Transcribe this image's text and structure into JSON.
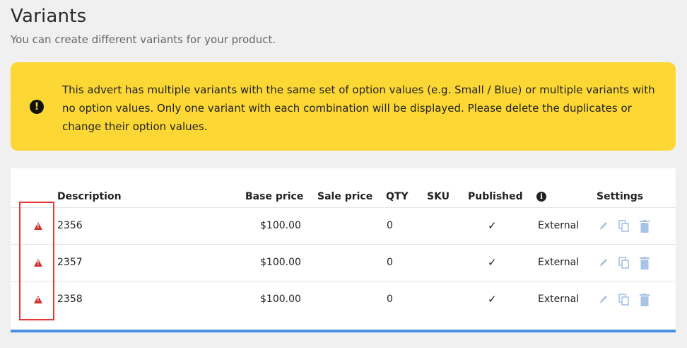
{
  "page": {
    "title": "Variants",
    "subtitle": "You can create different variants for your product."
  },
  "alert": {
    "icon": "exclamation-circle-icon",
    "message": "This advert has multiple variants with the same set of option values (e.g. Small / Blue) or multiple variants with no option values. Only one variant with each combination will be displayed. Please delete the duplicates or change their option values.",
    "color": "#fdd835"
  },
  "table": {
    "headers": {
      "description": "Description",
      "base_price": "Base price",
      "sale_price": "Sale price",
      "qty": "QTY",
      "sku": "SKU",
      "published": "Published",
      "info_icon": "info-icon",
      "settings": "Settings"
    },
    "rows": [
      {
        "warning_icon": "warning-triangle-icon",
        "description": "2356",
        "base_price": "$100.00",
        "sale_price": "",
        "qty": "0",
        "sku": "",
        "published": "✓",
        "source": "External"
      },
      {
        "warning_icon": "warning-triangle-icon",
        "description": "2357",
        "base_price": "$100.00",
        "sale_price": "",
        "qty": "0",
        "sku": "",
        "published": "✓",
        "source": "External"
      },
      {
        "warning_icon": "warning-triangle-icon",
        "description": "2358",
        "base_price": "$100.00",
        "sale_price": "",
        "qty": "0",
        "sku": "",
        "published": "✓",
        "source": "External"
      }
    ],
    "action_icons": [
      "edit-icon",
      "copy-icon",
      "trash-icon"
    ],
    "accent_color": "#4a90e2",
    "warning_color": "#d32f2f"
  }
}
